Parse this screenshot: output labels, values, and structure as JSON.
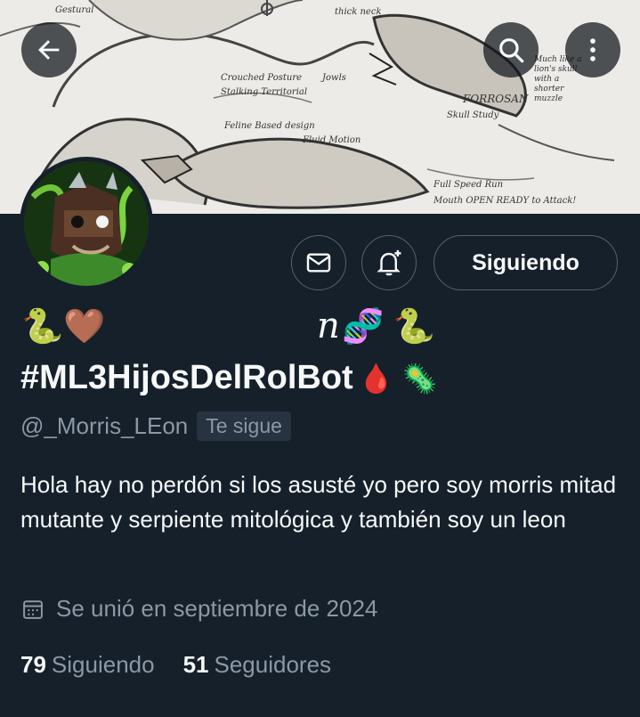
{
  "banner": {
    "notes": [
      "Crouched Posture",
      "Stalking Territorial",
      "Feline Based design",
      "Fluid Motion",
      "Jowls",
      "FORROSAN",
      "Skull Study",
      "Much like a lion's skull with a shorter muzzle",
      "Full Speed Run",
      "Mouth OPEN READY to Attack!",
      "Gestural",
      "thick neck"
    ]
  },
  "header": {
    "back_icon": "arrow-left-icon",
    "search_icon": "search-icon",
    "more_icon": "more-vertical-icon"
  },
  "actions": {
    "message_icon": "envelope-icon",
    "notify_icon": "bell-plus-icon",
    "follow_label": "Siguiendo"
  },
  "profile": {
    "emoji_line_left": "🐍🤎",
    "emoji_line_right_text": "n",
    "emoji_line_right": "🧬 🐍",
    "display_name": "#ML3HijosDelRolBot",
    "display_name_emojis": "🩸 🦠",
    "handle": "@_Morris_LEon",
    "follows_you": "Te sigue",
    "bio": "Hola hay no perdón si los asusté yo pero soy morris mitad mutante y serpiente mitológica y también soy un leon",
    "joined": "Se unió en septiembre de 2024",
    "following_count": "79",
    "following_label": "Siguiendo",
    "followers_count": "51",
    "followers_label": "Seguidores"
  },
  "colors": {
    "background": "#15202b",
    "text_primary": "#f7f9f9",
    "text_secondary": "#8b98a5",
    "border": "#536471"
  }
}
